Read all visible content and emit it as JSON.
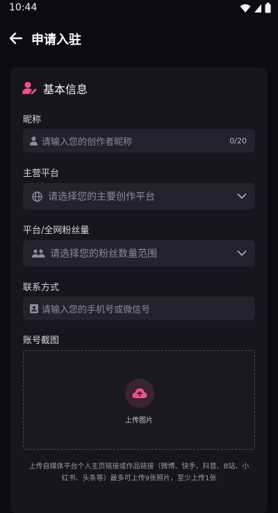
{
  "status": {
    "time": "10:44"
  },
  "header": {
    "title": "申请入驻"
  },
  "section": {
    "title": "基本信息"
  },
  "form": {
    "nickname": {
      "label": "昵称",
      "placeholder": "请输入您的创作者昵称",
      "counter": "0/20"
    },
    "platform": {
      "label": "主营平台",
      "placeholder": "请选择您的主要创作平台"
    },
    "fans": {
      "label": "平台/全网粉丝量",
      "placeholder": "请选择您的粉丝数量范围"
    },
    "contact": {
      "label": "联系方式",
      "placeholder": "请输入您的手机号或微信号"
    },
    "screenshot": {
      "label": "账号截图",
      "upload_label": "上传图片",
      "hint": "上传自媒体平台个人主页链接或作品链接（微博、快手、抖音、B站、小红书、头条等）最多可上传9张照片，至少上传1张"
    }
  },
  "colors": {
    "accent": "#f0508a",
    "background": "#0c0b14",
    "card": "#17161f",
    "field": "#23222e"
  },
  "icons": [
    "arrow-left-icon",
    "user-edit-icon",
    "user-icon",
    "globe-icon",
    "users-icon",
    "contact-card-icon",
    "chevron-down-icon",
    "cloud-upload-icon",
    "wifi-icon",
    "battery-icon"
  ]
}
